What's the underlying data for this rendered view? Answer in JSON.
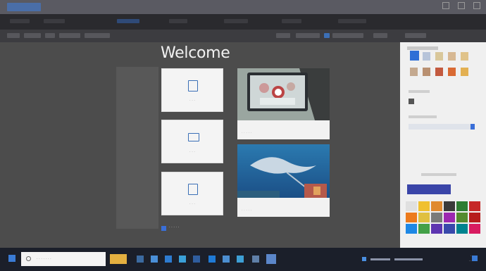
{
  "main": {
    "welcome_title": "Welcome",
    "options": [
      {
        "icon": "new-document-icon"
      },
      {
        "icon": "open-folder-icon"
      },
      {
        "icon": "template-icon"
      }
    ],
    "images": [
      {
        "kind": "presenter-photo"
      },
      {
        "kind": "manta-ray-photo"
      }
    ]
  },
  "colors": {
    "accent": "#3a6fd8",
    "titlebar": "#5a5a62",
    "taskbar": "#1b1f2a"
  }
}
